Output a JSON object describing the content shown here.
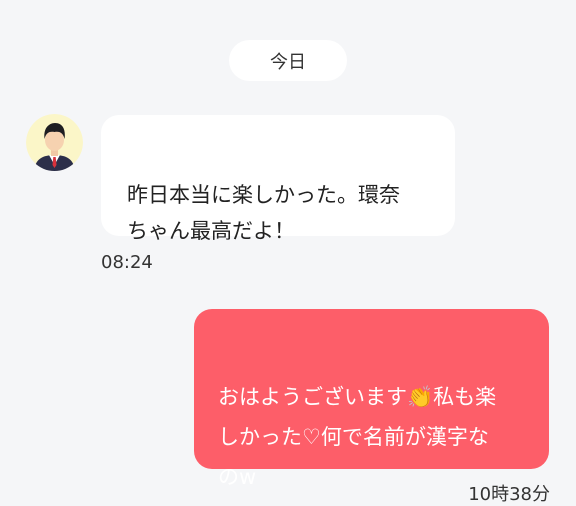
{
  "chat": {
    "date_label": "今日",
    "messages": [
      {
        "direction": "incoming",
        "avatar": "avatar-man-in-suit",
        "text": "昨日本当に楽しかった。環奈\nちゃん最高だよ！",
        "time": "08:24"
      },
      {
        "direction": "outgoing",
        "text": "おはようございます👏私も楽\nしかった♡何で名前が漢字な\nのw",
        "time": "10時38分"
      }
    ]
  },
  "colors": {
    "background": "#f5f6f8",
    "incoming_bubble": "#ffffff",
    "outgoing_bubble": "#fd5e69",
    "avatar_bg": "#fbf6c8"
  }
}
